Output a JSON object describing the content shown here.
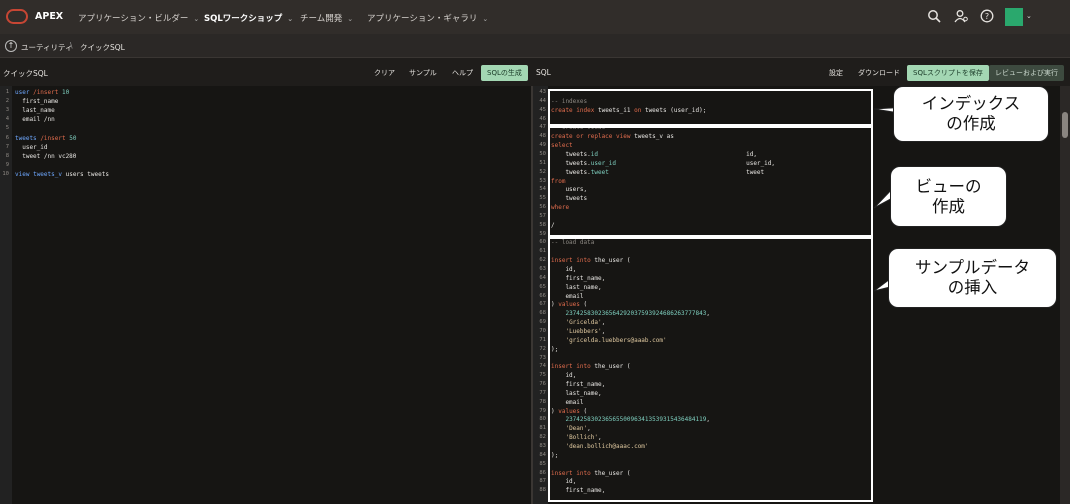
{
  "app": {
    "name": "APEX"
  },
  "topnav": [
    {
      "label": "アプリケーション・ビルダー",
      "active": false
    },
    {
      "label": "SQLワークショップ",
      "active": true
    },
    {
      "label": "チーム開発",
      "active": false
    },
    {
      "label": "アプリケーション・ギャラリ",
      "active": false
    }
  ],
  "topnav_icons": [
    "search-icon",
    "user-help-icon",
    "help-icon",
    "avatar"
  ],
  "breadcrumb": [
    "ユーティリティ",
    "クイックSQL"
  ],
  "left_panel": {
    "title": "クイックSQL",
    "buttons": [
      "クリア",
      "サンプル",
      "ヘルプ",
      "SQLの生成"
    ]
  },
  "right_panel": {
    "title": "SQL",
    "buttons": [
      "設定",
      "ダウンロード",
      "SQLスクリプトを保存",
      "レビューおよび実行"
    ]
  },
  "left_code": [
    {
      "n": "1",
      "t": "user /insert 10"
    },
    {
      "n": "2",
      "t": "  first_name"
    },
    {
      "n": "3",
      "t": "  last_name"
    },
    {
      "n": "4",
      "t": "  email /nn"
    },
    {
      "n": "5",
      "t": ""
    },
    {
      "n": "6",
      "t": "tweets /insert 50"
    },
    {
      "n": "7",
      "t": "  user_id"
    },
    {
      "n": "8",
      "t": "  tweet /nn vc280"
    },
    {
      "n": "9",
      "t": ""
    },
    {
      "n": "10",
      "t": "view tweets_v users tweets"
    }
  ],
  "right_code": [
    {
      "n": "43",
      "t": ""
    },
    {
      "n": "44",
      "t": "-- indexes"
    },
    {
      "n": "45",
      "t": "create index tweets_i1 on tweets (user_id);"
    },
    {
      "n": "46",
      "t": ""
    },
    {
      "n": "47",
      "t": "-- create views"
    },
    {
      "n": "48",
      "t": "create or replace view tweets_v as"
    },
    {
      "n": "49",
      "t": "select"
    },
    {
      "n": "50",
      "t": "    tweets.id                                         id,"
    },
    {
      "n": "51",
      "t": "    tweets.user_id                                    user_id,"
    },
    {
      "n": "52",
      "t": "    tweets.tweet                                      tweet"
    },
    {
      "n": "53",
      "t": "from"
    },
    {
      "n": "54",
      "t": "    users,"
    },
    {
      "n": "55",
      "t": "    tweets"
    },
    {
      "n": "56",
      "t": "where"
    },
    {
      "n": "57",
      "t": ""
    },
    {
      "n": "58",
      "t": "/"
    },
    {
      "n": "59",
      "t": ""
    },
    {
      "n": "60",
      "t": "-- load data"
    },
    {
      "n": "61",
      "t": ""
    },
    {
      "n": "62",
      "t": "insert into the_user ("
    },
    {
      "n": "63",
      "t": "    id,"
    },
    {
      "n": "64",
      "t": "    first_name,"
    },
    {
      "n": "65",
      "t": "    last_name,"
    },
    {
      "n": "66",
      "t": "    email"
    },
    {
      "n": "67",
      "t": ") values ("
    },
    {
      "n": "68",
      "t": "    237425830236564292037593924686263777843,"
    },
    {
      "n": "69",
      "t": "    'Gricelda',"
    },
    {
      "n": "70",
      "t": "    'Luebbers',"
    },
    {
      "n": "71",
      "t": "    'gricelda.luebbers@aaab.com'"
    },
    {
      "n": "72",
      "t": ");"
    },
    {
      "n": "73",
      "t": ""
    },
    {
      "n": "74",
      "t": "insert into the_user ("
    },
    {
      "n": "75",
      "t": "    id,"
    },
    {
      "n": "76",
      "t": "    first_name,"
    },
    {
      "n": "77",
      "t": "    last_name,"
    },
    {
      "n": "78",
      "t": "    email"
    },
    {
      "n": "79",
      "t": ") values ("
    },
    {
      "n": "80",
      "t": "    237425830236565500963413539315436484119,"
    },
    {
      "n": "81",
      "t": "    'Dean',"
    },
    {
      "n": "82",
      "t": "    'Bollich',"
    },
    {
      "n": "83",
      "t": "    'dean.bollich@aaac.com'"
    },
    {
      "n": "84",
      "t": ");"
    },
    {
      "n": "85",
      "t": ""
    },
    {
      "n": "86",
      "t": "insert into the_user ("
    },
    {
      "n": "87",
      "t": "    id,"
    },
    {
      "n": "88",
      "t": "    first_name,"
    }
  ],
  "annotations": [
    {
      "line1": "インデックス",
      "line2": "の作成"
    },
    {
      "line1": "ビューの",
      "line2": "作成"
    },
    {
      "line1": "サンプルデータ",
      "line2": "の挿入"
    }
  ],
  "colors": {
    "accent": "#c74634",
    "button_green": "#a3d7b3",
    "avatar": "#2aa86d"
  }
}
